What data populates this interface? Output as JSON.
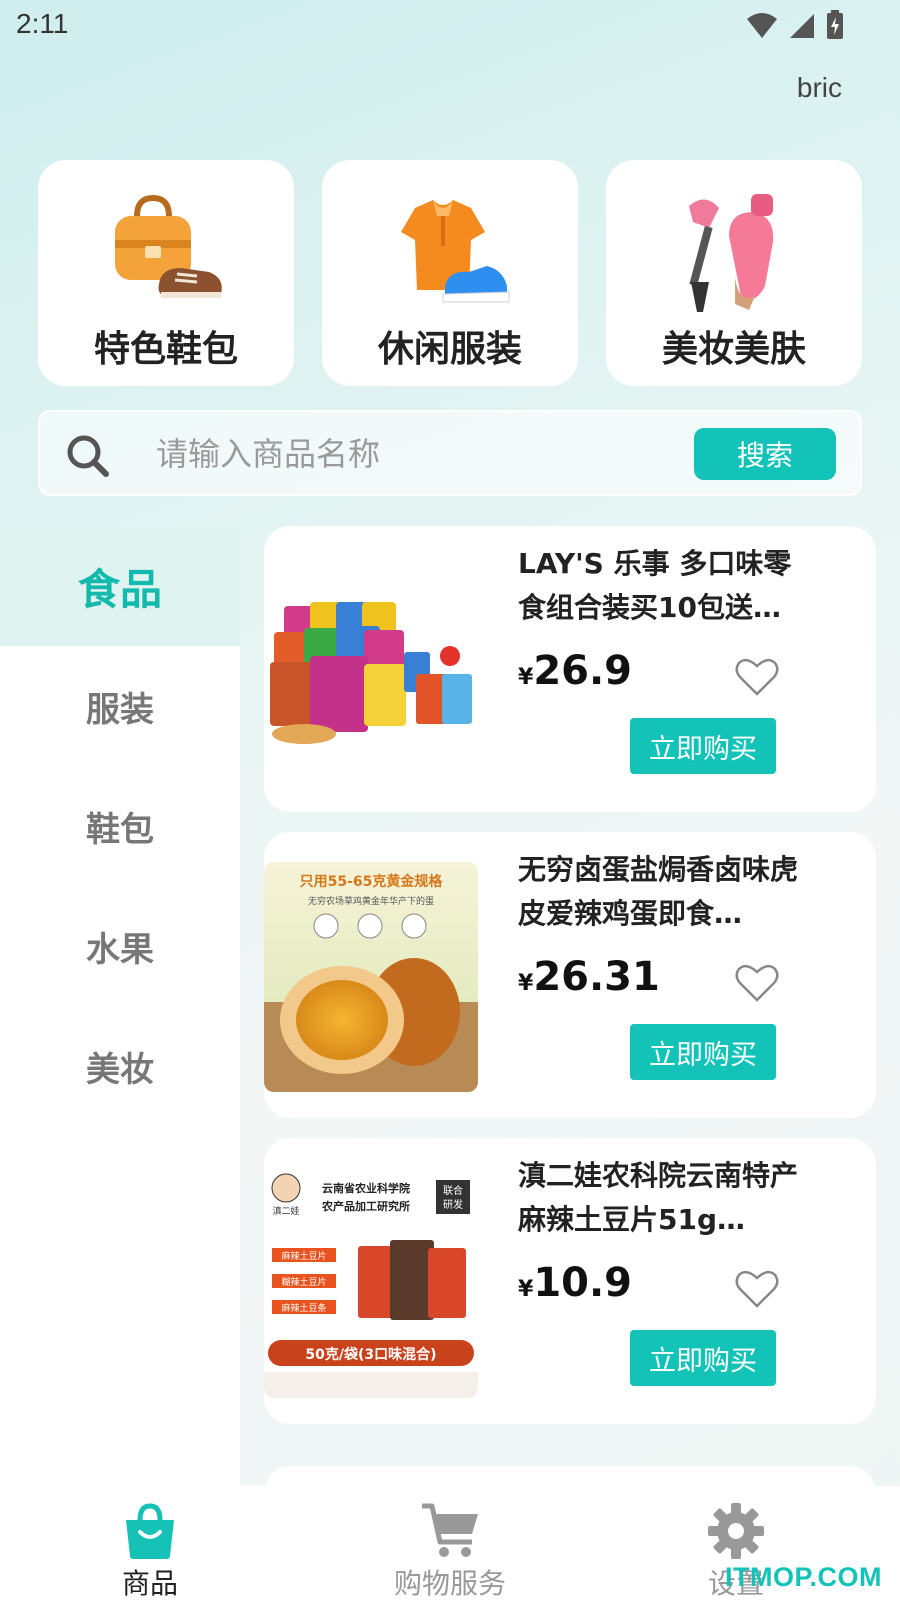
{
  "status_bar": {
    "time": "2:11"
  },
  "user": {
    "name": "bric"
  },
  "categories": [
    {
      "label": "特色鞋包",
      "icon": "bag-shoes-icon"
    },
    {
      "label": "休闲服装",
      "icon": "shirt-sneaker-icon"
    },
    {
      "label": "美妆美肤",
      "icon": "cosmetics-icon"
    }
  ],
  "search": {
    "placeholder": "请输入商品名称",
    "button_label": "搜索"
  },
  "sidebar": {
    "items": [
      {
        "label": "食品",
        "active": true
      },
      {
        "label": "服装",
        "active": false
      },
      {
        "label": "鞋包",
        "active": false
      },
      {
        "label": "水果",
        "active": false
      },
      {
        "label": "美妆",
        "active": false
      }
    ]
  },
  "products": [
    {
      "title": "LAY'S 乐事 多口味零食组合装买10包送3…",
      "currency": "¥",
      "price": "26.9",
      "buy_label": "立即购买",
      "image": "chips-bags-image"
    },
    {
      "title": "无穷卤蛋盐焗香卤味虎皮爱辣鸡蛋即食…",
      "currency": "¥",
      "price": "26.31",
      "buy_label": "立即购买",
      "image": "braised-egg-image",
      "image_text": {
        "headline": "只用55-65克黄金规格",
        "sub": "无穷农场草鸡黄金年华产下的蛋"
      }
    },
    {
      "title": "滇二娃农科院云南特产麻辣土豆片51g…",
      "currency": "¥",
      "price": "10.9",
      "buy_label": "立即购买",
      "image": "potato-chips-image",
      "image_text": {
        "brand": "滇二娃",
        "line1": "云南省农业科学院",
        "line2": "农产品加工研究所",
        "tag1": "联合",
        "tag2": "研发",
        "flavor1": "麻辣土豆片",
        "flavor2": "糊辣土豆片",
        "flavor3": "麻辣土豆条",
        "banner": "50克/袋(3口味混合)"
      }
    }
  ],
  "bottom_nav": [
    {
      "label": "商品",
      "icon": "shopping-bag-icon",
      "active": true
    },
    {
      "label": "购物服务",
      "icon": "cart-icon",
      "active": false
    },
    {
      "label": "设置",
      "icon": "gear-icon",
      "active": false
    }
  ],
  "watermark": "ITMOP.COM",
  "colors": {
    "accent": "#14c3b8",
    "active_bg": "#dff3f1"
  }
}
